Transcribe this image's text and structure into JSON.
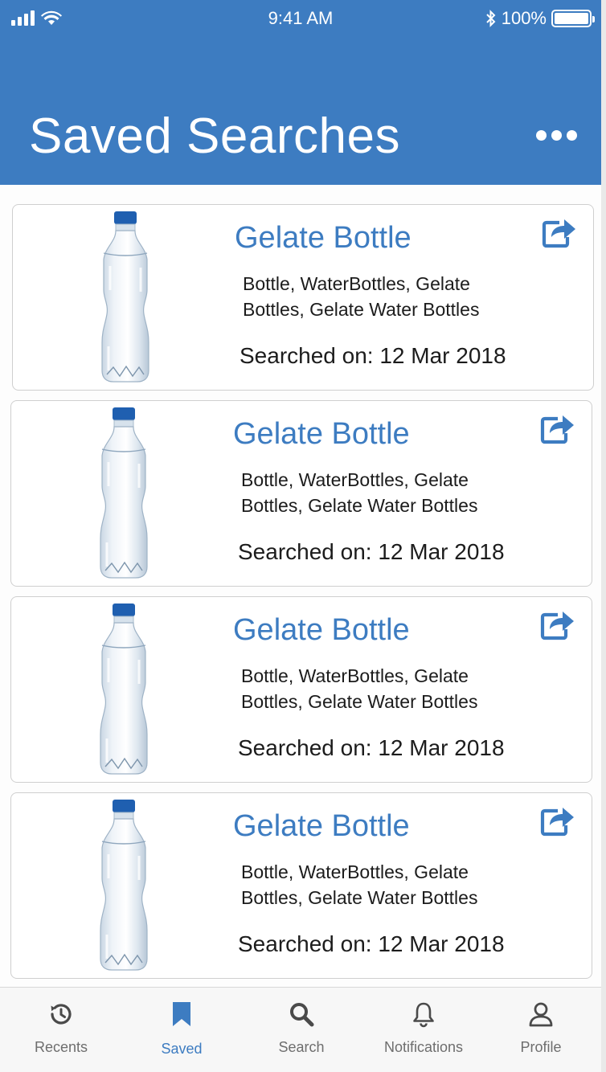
{
  "status_bar": {
    "time": "9:41 AM",
    "battery": "100%"
  },
  "header": {
    "title": "Saved Searches"
  },
  "colors": {
    "accent": "#3d7cc1",
    "tab_inactive": "#6e6e6e"
  },
  "cards": [
    {
      "title": "Gelate Bottle",
      "tags": "Bottle, WaterBottles, Gelate Bottles, Gelate Water Bottles",
      "date": "Searched on: 12 Mar 2018"
    },
    {
      "title": "Gelate Bottle",
      "tags": "Bottle, WaterBottles, Gelate Bottles, Gelate Water Bottles",
      "date": "Searched on: 12 Mar 2018"
    },
    {
      "title": "Gelate Bottle",
      "tags": "Bottle, WaterBottles, Gelate Bottles, Gelate Water Bottles",
      "date": "Searched on: 12 Mar 2018"
    },
    {
      "title": "Gelate Bottle",
      "tags": "Bottle, WaterBottles, Gelate Bottles, Gelate Water Bottles",
      "date": "Searched on: 12 Mar 2018"
    }
  ],
  "tabs": [
    {
      "label": "Recents",
      "icon": "history-icon",
      "active": false
    },
    {
      "label": "Saved",
      "icon": "bookmark-icon",
      "active": true
    },
    {
      "label": "Search",
      "icon": "search-icon",
      "active": false
    },
    {
      "label": "Notifications",
      "icon": "bell-icon",
      "active": false
    },
    {
      "label": "Profile",
      "icon": "user-icon",
      "active": false
    }
  ]
}
